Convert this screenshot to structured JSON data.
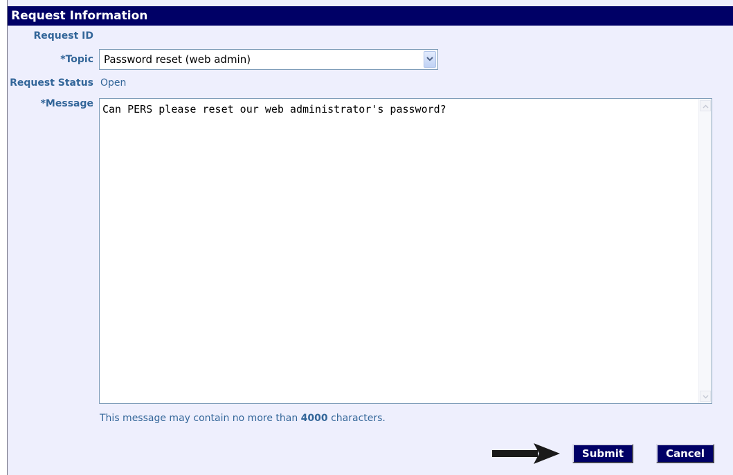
{
  "header": {
    "title": "Request Information"
  },
  "form": {
    "request_id_label": "Request ID",
    "request_id_value": "",
    "topic_label": "*Topic",
    "topic_value": "Password reset (web admin)",
    "status_label": "Request Status",
    "status_value": "Open",
    "message_label": "*Message",
    "message_value": "Can PERS please reset our web administrator's password?",
    "hint_prefix": "This message may contain no more than ",
    "hint_limit": "4000",
    "hint_suffix": " characters."
  },
  "actions": {
    "submit_label": "Submit",
    "cancel_label": "Cancel"
  },
  "icons": {
    "dropdown": "chevron-down-icon",
    "pointer": "arrow-right-icon",
    "scroll_up": "scroll-up-icon",
    "scroll_down": "scroll-down-icon"
  },
  "colors": {
    "header_bg": "#000066",
    "label": "#336699",
    "panel_bg": "#eeeffd"
  }
}
